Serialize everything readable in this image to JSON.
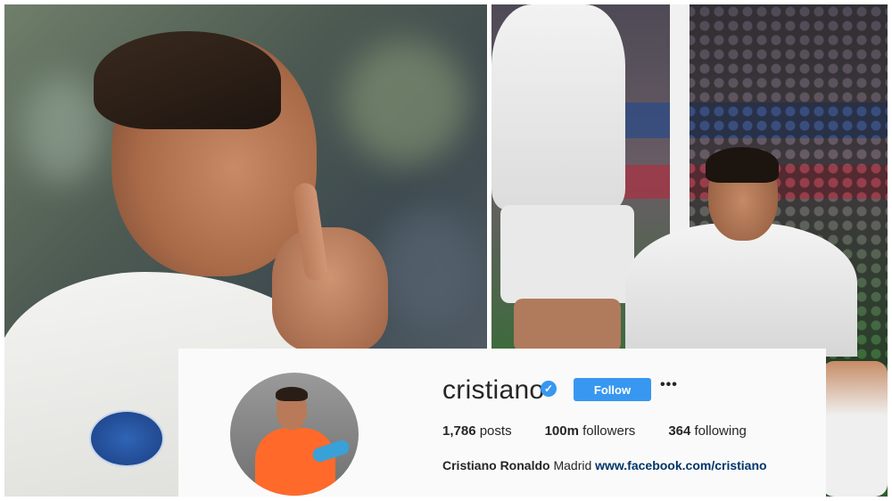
{
  "profile": {
    "username": "cristiano",
    "verified": true,
    "follow_label": "Follow",
    "more_label": "•••",
    "stats": {
      "posts_count": "1,786",
      "posts_label": "posts",
      "followers_count": "100m",
      "followers_label": "followers",
      "following_count": "364",
      "following_label": "following"
    },
    "bio": {
      "full_name": "Cristiano Ronaldo",
      "location": "Madrid",
      "link": "www.facebook.com/cristiano"
    }
  },
  "colors": {
    "accent": "#3897f0",
    "text": "#262626",
    "link": "#003569",
    "card_bg": "#fafafa"
  },
  "icons": {
    "verified": "verified-badge-icon",
    "more": "more-options-icon"
  }
}
